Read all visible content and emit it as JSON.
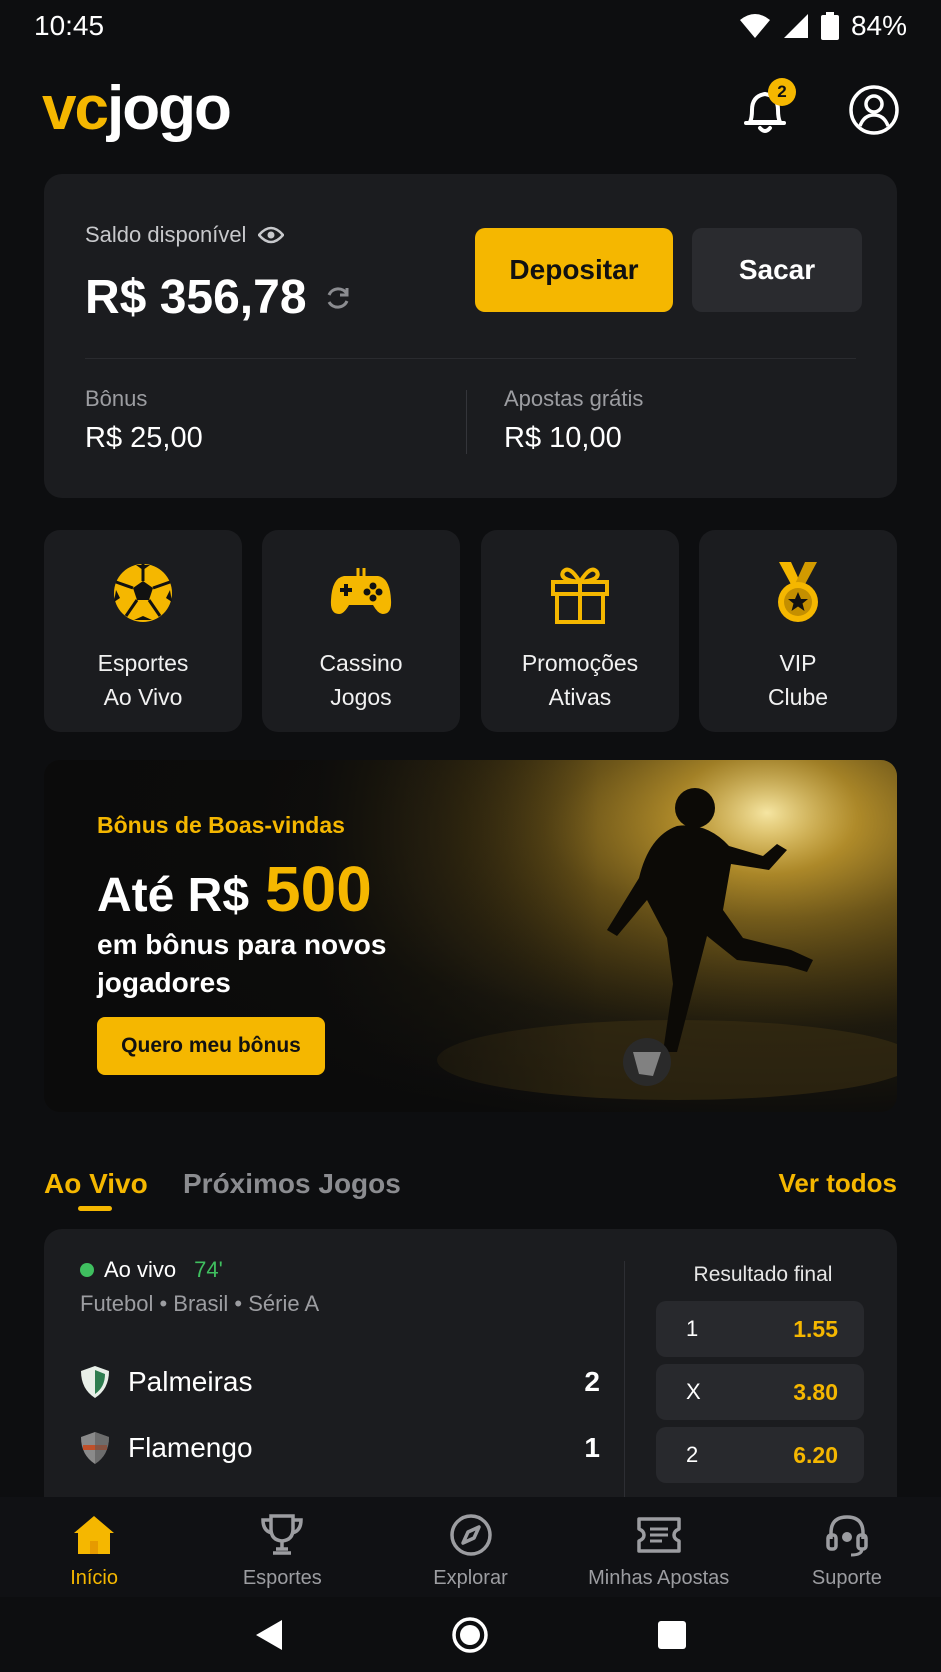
{
  "status_bar": {
    "time": "10:45",
    "battery": "84%"
  },
  "header": {
    "logo_part1": "vc",
    "logo_part2": "jogo",
    "notification_count": "2"
  },
  "balance": {
    "label": "Saldo disponível",
    "value": "R$ 356,78",
    "deposit_label": "Depositar",
    "withdraw_label": "Sacar",
    "bonus_label": "Bônus",
    "bonus_value": "R$ 25,00",
    "free_bets_label": "Apostas grátis",
    "free_bets_value": "R$ 10,00"
  },
  "quick_tiles": [
    {
      "label": "Esportes\nAo Vivo",
      "icon": "soccer-ball-icon"
    },
    {
      "label": "Cassino\nJogos",
      "icon": "gamepad-icon"
    },
    {
      "label": "Promoções\nAtivas",
      "icon": "gift-icon"
    },
    {
      "label": "VIP\nClube",
      "icon": "medal-icon"
    }
  ],
  "banner": {
    "kicker": "Bônus de Boas-vindas",
    "title_prefix": "Até R$",
    "title_amount": "500",
    "subtitle": "em bônus para novos jogadores",
    "cta": "Quero meu bônus"
  },
  "tabs": {
    "live": "Ao Vivo",
    "upcoming": "Próximos Jogos",
    "see_all": "Ver todos"
  },
  "match": {
    "status": "Ao vivo",
    "minute": "74'",
    "league": "Futebol • Brasil • Série A",
    "home_team": "Palmeiras",
    "home_score": "2",
    "away_team": "Flamengo",
    "away_score": "1",
    "market": "Resultado final",
    "odds": [
      {
        "label": "1",
        "value": "1.55"
      },
      {
        "label": "X",
        "value": "3.80"
      },
      {
        "label": "2",
        "value": "6.20"
      }
    ]
  },
  "bottom_nav": [
    {
      "label": "Início",
      "icon": "home-icon",
      "active": true
    },
    {
      "label": "Esportes",
      "icon": "trophy-icon",
      "active": false
    },
    {
      "label": "Explorar",
      "icon": "compass-icon",
      "active": false
    },
    {
      "label": "Minhas Apostas",
      "icon": "ticket-icon",
      "active": false
    },
    {
      "label": "Suporte",
      "icon": "headset-icon",
      "active": false
    }
  ],
  "colors": {
    "accent": "#f5b700",
    "background": "#0d0e10",
    "card": "#1b1c1f",
    "live_green": "#3fbf5f"
  }
}
